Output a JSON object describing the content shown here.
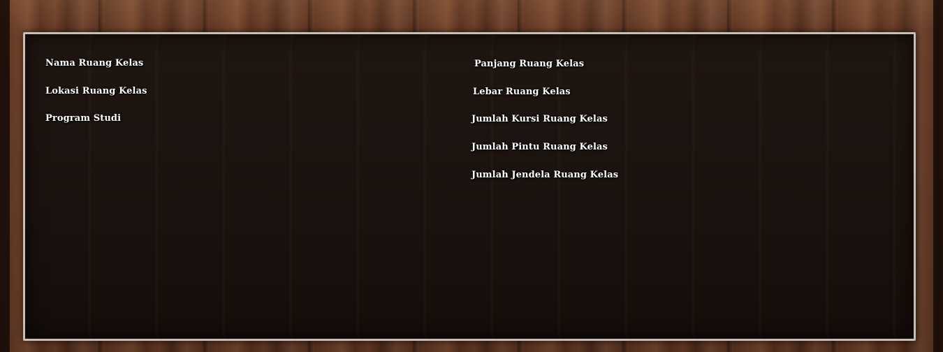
{
  "left_column": {
    "fields": [
      {
        "label": "Nama Ruang Kelas"
      },
      {
        "label": "Lokasi Ruang Kelas"
      },
      {
        "label": "Program Studi"
      }
    ]
  },
  "right_column": {
    "fields": [
      {
        "label": "Panjang Ruang Kelas"
      },
      {
        "label": "Lebar Ruang Kelas"
      },
      {
        "label": "Jumlah Kursi Ruang Kelas"
      },
      {
        "label": "Jumlah Pintu Ruang Kelas"
      },
      {
        "label": "Jumlah Jendela Ruang Kelas"
      }
    ]
  },
  "colors": {
    "panel_background": "#1a120e",
    "panel_border": "#c8beb6",
    "label_text": "#ffffff",
    "wood": "#6d4029"
  }
}
